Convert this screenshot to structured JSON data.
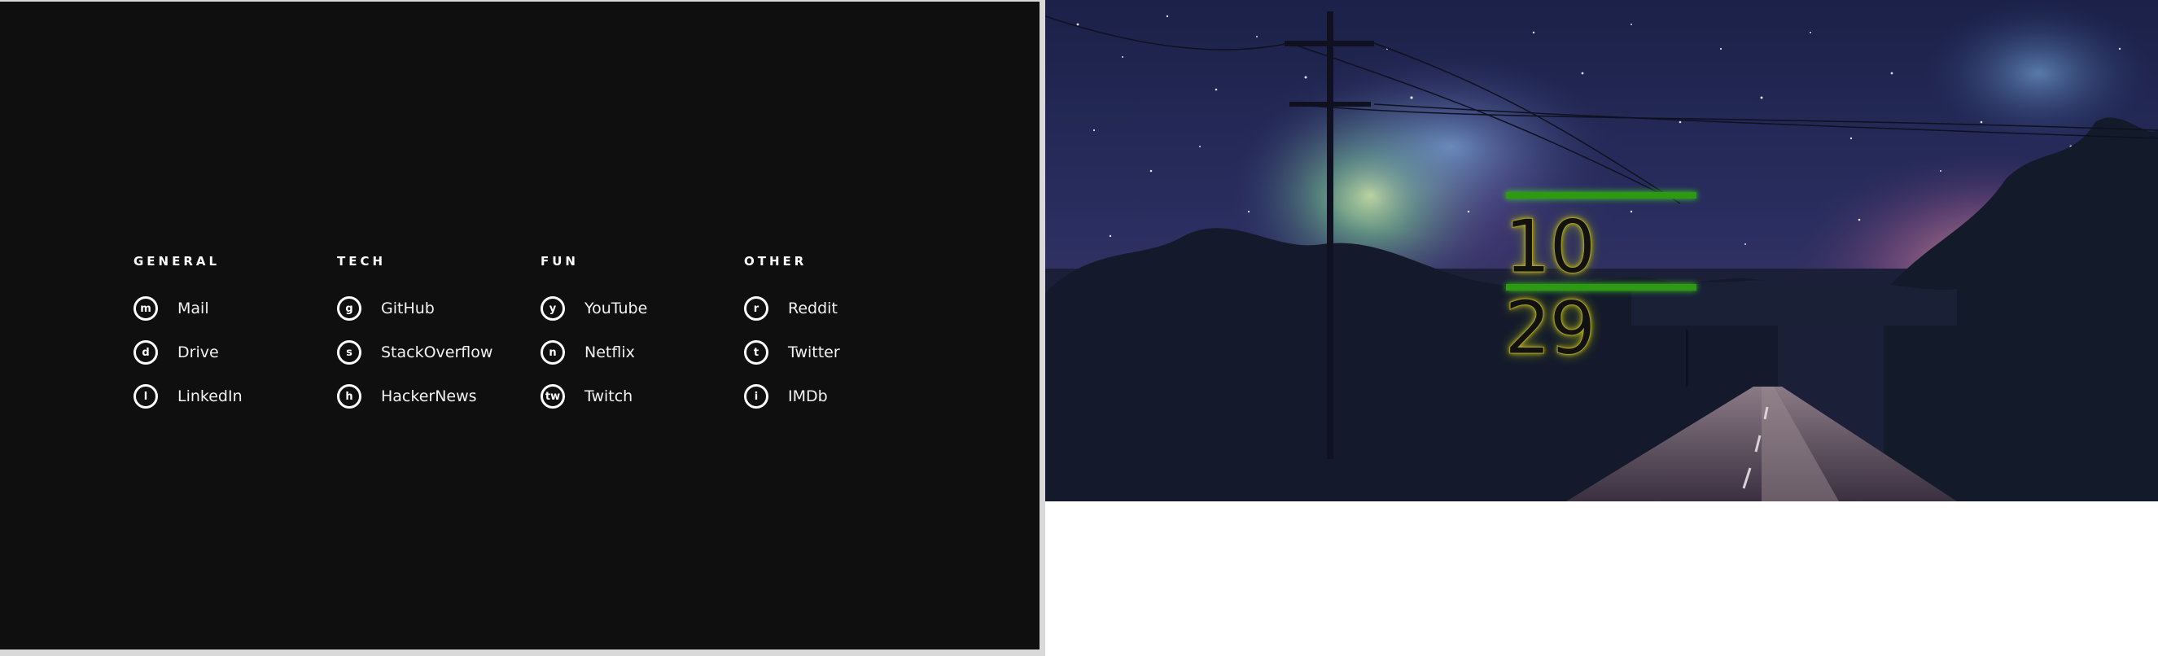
{
  "columns": [
    {
      "title": "GENERAL",
      "links": [
        {
          "key": "m",
          "label": "Mail"
        },
        {
          "key": "d",
          "label": "Drive"
        },
        {
          "key": "l",
          "label": "LinkedIn"
        }
      ]
    },
    {
      "title": "TECH",
      "links": [
        {
          "key": "g",
          "label": "GitHub"
        },
        {
          "key": "s",
          "label": "StackOverflow"
        },
        {
          "key": "h",
          "label": "HackerNews"
        }
      ]
    },
    {
      "title": "FUN",
      "links": [
        {
          "key": "y",
          "label": "YouTube"
        },
        {
          "key": "n",
          "label": "Netflix"
        },
        {
          "key": "tw",
          "label": "Twitch"
        }
      ]
    },
    {
      "title": "OTHER",
      "links": [
        {
          "key": "r",
          "label": "Reddit"
        },
        {
          "key": "t",
          "label": "Twitter"
        },
        {
          "key": "i",
          "label": "IMDb"
        }
      ]
    }
  ],
  "clock": {
    "time": "10 29"
  },
  "colors": {
    "panel_bg": "#0f0f0f",
    "text": "#ffffff",
    "clock_accent": "#2e9a14"
  }
}
